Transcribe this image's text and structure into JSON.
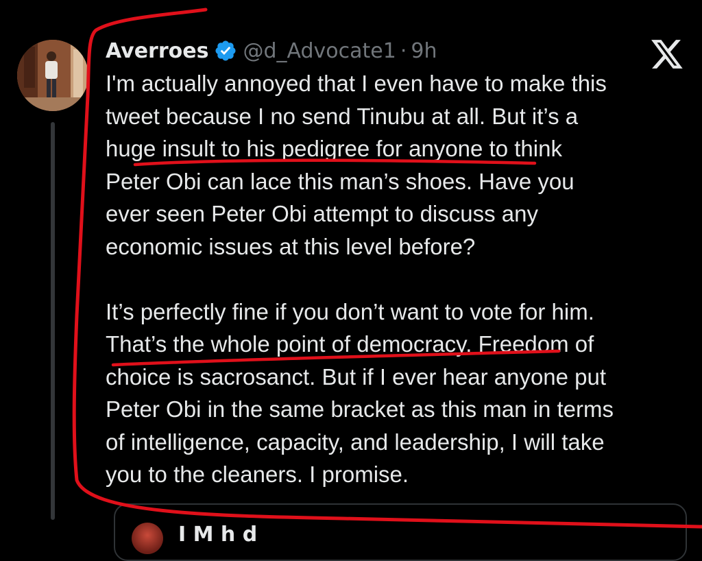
{
  "tweet": {
    "display_name": "Averroes",
    "handle": "@d_Advocate1",
    "separator": "·",
    "time": "9h",
    "verified_icon": "verified-badge-icon",
    "lines": [
      "I'm actually annoyed that I even have to make this",
      "tweet because I no send Tinubu at all. But it’s a",
      "huge insult to his pedigree for anyone to think",
      "Peter Obi can lace this man’s shoes. Have you",
      "ever seen Peter Obi attempt to discuss any",
      "economic issues at this level before?",
      "",
      "It’s perfectly fine if you don’t want to vote for him.",
      "That’s the whole point of democracy. Freedom of",
      "choice is sacrosanct. But if I ever hear anyone put",
      "Peter Obi in the same bracket as this man in terms",
      "of intelligence, capacity, and leadership, I will take",
      "you to the cleaners. I promise."
    ]
  },
  "quoted_tweet": {
    "name_partial": "I M h d"
  },
  "colors": {
    "background": "#000000",
    "text": "#e7e9ea",
    "secondary": "#71767b",
    "verified": "#1d9bf0",
    "annotation": "#e0101a"
  },
  "icons": {
    "platform_logo": "x-logo-icon"
  }
}
